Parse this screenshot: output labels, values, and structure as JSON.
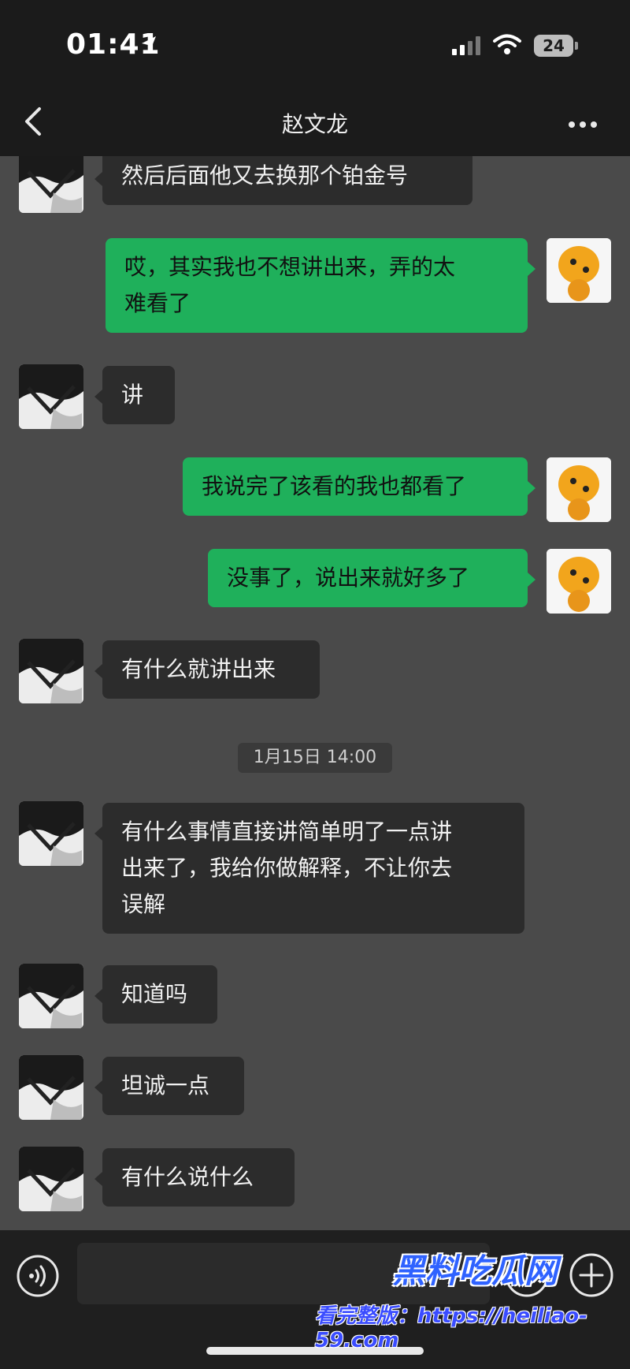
{
  "status_bar": {
    "time": "01:41",
    "battery": "24"
  },
  "nav": {
    "title": "赵文龙"
  },
  "messages": [
    {
      "side": "left",
      "text": "然后后面他又去换那个铂金号"
    },
    {
      "side": "right",
      "text": "哎，其实我也不想讲出来，弄的太\n难看了"
    },
    {
      "side": "left",
      "text": "讲"
    },
    {
      "side": "right",
      "text": "我说完了该看的我也都看了"
    },
    {
      "side": "right",
      "text": "没事了，说出来就好多了"
    },
    {
      "side": "left",
      "text": "有什么就讲出来"
    },
    {
      "side": "left",
      "text": "有什么事情直接讲简单明了一点讲\n出来了，我给你做解释，不让你去\n误解"
    },
    {
      "side": "left",
      "text": "知道吗"
    },
    {
      "side": "left",
      "text": "坦诚一点"
    },
    {
      "side": "left",
      "text": "有什么说什么"
    }
  ],
  "timestamp": "1月15日 14:00",
  "watermark": {
    "logo": "黑料吃瓜网",
    "url": "看完整版：https://heiliao-59.com"
  },
  "colors": {
    "bubble_out": "#1fb05b",
    "bubble_in": "#2c2c2c",
    "bg": "#4a4a4a"
  }
}
